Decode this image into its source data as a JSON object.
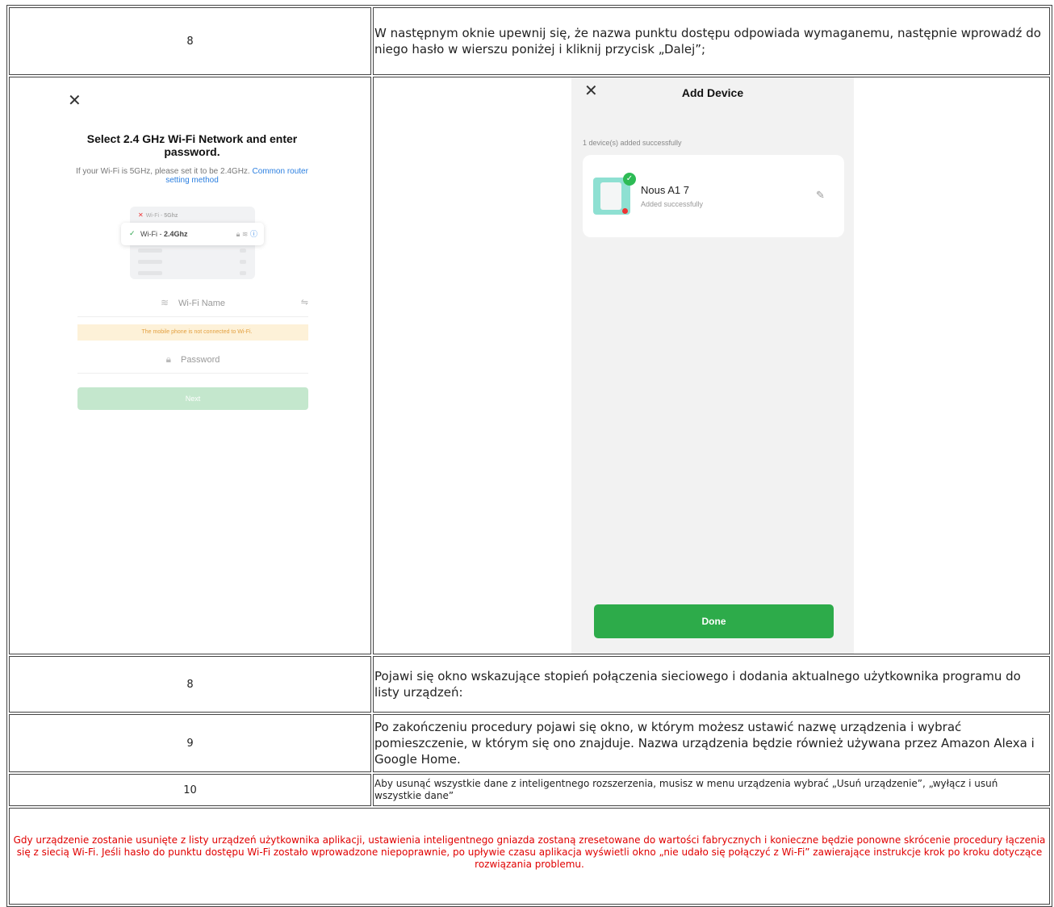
{
  "rows": [
    {
      "step": "8",
      "text": "W następnym oknie upewnij się, że nazwa punktu dostępu odpowiada wymaganemu, następnie wprowadź do niego hasło w wierszu poniżej i kliknij przycisk „Dalej”;"
    },
    {
      "step": "8",
      "text": "Pojawi się okno wskazujące stopień połączenia sieciowego i dodania aktualnego użytkownika programu do listy urządzeń:"
    },
    {
      "step": "9",
      "text": "Po zakończeniu procedury pojawi się okno, w którym możesz ustawić nazwę urządzenia i wybrać pomieszczenie, w którym się ono znajduje. Nazwa urządzenia będzie również używana przez Amazon Alexa i Google Home."
    },
    {
      "step": "10",
      "text": "Aby usunąć wszystkie dane z inteligentnego rozszerzenia, musisz w menu urządzenia wybrać „Usuń urządzenie”, „wyłącz i usuń wszystkie dane”"
    }
  ],
  "note": "Gdy urządzenie zostanie usunięte z listy urządzeń użytkownika aplikacji, ustawienia  inteligentnego  gniazda zostaną zresetowane do wartości fabrycznych i konieczne będzie ponowne skrócenie procedury łączenia się z siecią Wi-Fi. Jeśli hasło do punktu dostępu Wi-Fi zostało wprowadzone niepoprawnie, po upływie czasu aplikacja wyświetli okno „nie udało się połączyć z Wi-Fi” zawierające instrukcje krok po kroku dotyczące rozwiązania problemu.",
  "wifi_screen": {
    "close_glyph": "✕",
    "title": "Select 2.4 GHz Wi-Fi Network and enter password.",
    "hint": "If your Wi-Fi is 5GHz, please set it to be 2.4GHz.",
    "hint_link": "Common router setting method",
    "network_5g_prefix": "Wi-Fi - ",
    "network_5g": "5Ghz",
    "network_24_prefix": "Wi-Fi - ",
    "network_24": "2.4Ghz",
    "wifi_name_placeholder": "Wi-Fi Name",
    "warning": "The mobile phone is not connected to Wi-Fi.",
    "password_placeholder": "Password",
    "next_button": "Next"
  },
  "add_device_screen": {
    "close_glyph": "✕",
    "title": "Add Device",
    "subtitle": "1 device(s) added successfully",
    "device_name": "Nous A1   7",
    "device_status": "Added successfully",
    "done_button": "Done"
  },
  "colors": {
    "note_text": "#e00000",
    "next_button_disabled": "#c4e7cd",
    "done_button": "#2dab4a",
    "link": "#2b7fe0",
    "warning_bg": "#fdf1d8",
    "warning_text": "#e3a040"
  }
}
